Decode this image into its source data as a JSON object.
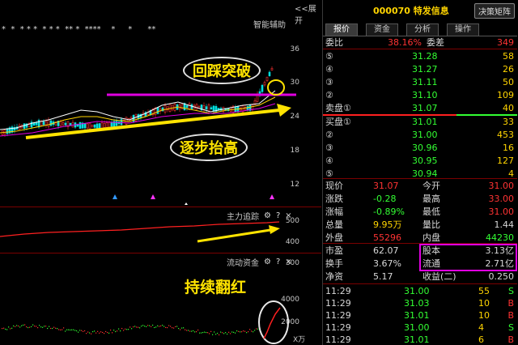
{
  "chart": {
    "expand_label": "<<展开",
    "smart_assist": "智能辅助",
    "markers_row": "*  *  * * *  * * *  ** *  ****    *     *      **",
    "price_axis": [
      "36",
      "30",
      "24",
      "18",
      "12"
    ],
    "callout_breakout": "回踩突破",
    "callout_rising": "逐步抬高",
    "callout_red": "持续翻红",
    "main_tracking_title": "主力追踪",
    "main_tracking_axis": [
      "500",
      "400",
      "300"
    ],
    "liquidity_title": "流动资金",
    "liquidity_axis": [
      "4000",
      "2000"
    ],
    "liquidity_unit": "X万",
    "help_icon": "?",
    "close_icon": "×"
  },
  "header": {
    "code_name": "000070 特发信息",
    "decision_button": "决策矩阵"
  },
  "tabs": [
    "报价",
    "资金",
    "分析",
    "操作"
  ],
  "order_book": {
    "ratio_label": "委比",
    "ratio_value": "38.16%",
    "diff_label": "委差",
    "diff_value": "349",
    "asks": [
      {
        "label": "⑤",
        "price": "31.28",
        "vol": "58"
      },
      {
        "label": "④",
        "price": "31.27",
        "vol": "26"
      },
      {
        "label": "③",
        "price": "31.11",
        "vol": "50"
      },
      {
        "label": "②",
        "price": "31.10",
        "vol": "109"
      },
      {
        "label": "卖盘①",
        "price": "31.07",
        "vol": "40"
      }
    ],
    "bids": [
      {
        "label": "买盘①",
        "price": "31.01",
        "vol": "33"
      },
      {
        "label": "②",
        "price": "31.00",
        "vol": "453"
      },
      {
        "label": "③",
        "price": "30.96",
        "vol": "16"
      },
      {
        "label": "④",
        "price": "30.95",
        "vol": "127"
      },
      {
        "label": "⑤",
        "price": "30.94",
        "vol": "4"
      }
    ]
  },
  "quote": {
    "rows": [
      {
        "l1": "现价",
        "v1": "31.07",
        "c1": "red",
        "l2": "今开",
        "v2": "31.00",
        "c2": "red"
      },
      {
        "l1": "涨跌",
        "v1": "-0.28",
        "c1": "green",
        "l2": "最高",
        "v2": "33.00",
        "c2": "red"
      },
      {
        "l1": "涨幅",
        "v1": "-0.89%",
        "c1": "green",
        "l2": "最低",
        "v2": "31.00",
        "c2": "red"
      },
      {
        "l1": "总量",
        "v1": "9.95万",
        "c1": "yellow",
        "l2": "量比",
        "v2": "1.44",
        "c2": "white"
      },
      {
        "l1": "外盘",
        "v1": "55296",
        "c1": "red",
        "l2": "内盘",
        "v2": "44230",
        "c2": "green"
      }
    ],
    "market_value_label": "市盈",
    "market_value": "62.07",
    "share_capital_label": "股本",
    "share_capital": "3.13亿",
    "turnover_label": "换手",
    "turnover": "3.67%",
    "float_label": "流通",
    "float_value": "2.71亿",
    "net_assets_label": "净资",
    "net_assets": "5.17",
    "eps_label": "收益(二)",
    "eps": "0.250"
  },
  "ticks": [
    {
      "time": "11:29",
      "price": "31.00",
      "vol": "55",
      "side": "S"
    },
    {
      "time": "11:29",
      "price": "31.03",
      "vol": "10",
      "side": "B"
    },
    {
      "time": "11:29",
      "price": "31.01",
      "vol": "10",
      "side": "B"
    },
    {
      "time": "11:29",
      "price": "31.00",
      "vol": "4",
      "side": "S"
    },
    {
      "time": "11:29",
      "price": "31.01",
      "vol": "6",
      "side": "B"
    }
  ],
  "colors": {
    "up": "#ff3333",
    "down": "#33ff33",
    "highlight": "#ffd400",
    "magenta": "#e000e0"
  }
}
